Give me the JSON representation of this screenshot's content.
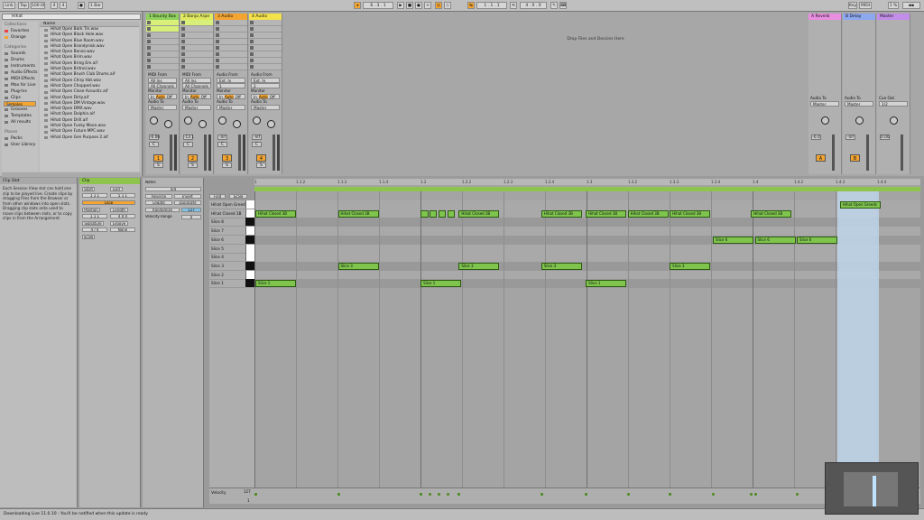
{
  "transport": {
    "link": "Link",
    "tap": "Tap",
    "tempo": "100.00",
    "sig_num": "4",
    "sig_den": "4",
    "quant": "1 Bar",
    "pos": "6 . 3 . 1",
    "loop_start": "1 . 1 . 1",
    "loop_len": "4 . 0 . 0",
    "midi": "MIDI",
    "cpu": "1 %",
    "key": "Key"
  },
  "browser": {
    "search": "Hihat",
    "collections_hdr": "Collections",
    "favorites": "Favorites",
    "orange": "Orange",
    "categories_hdr": "Categories",
    "categories": [
      "Sounds",
      "Drums",
      "Instruments",
      "Audio Effects",
      "MIDI Effects",
      "Max for Live",
      "Plug-Ins",
      "Clips",
      "Samples",
      "Grooves",
      "Templates",
      "All results"
    ],
    "places_hdr": "Places",
    "places": [
      "Packs",
      "User Library"
    ],
    "files_hdr": "Name",
    "files": [
      "Hihat Open Bark Tin.wav",
      "Hihat Open Black Hole.wav",
      "Hihat Open Blue Room.wav",
      "Hihat Open Brandynisk.wav",
      "Hihat Open Bonzo.wav",
      "Hihat Open Brim.wav",
      "Hihat Open Bring Em.aif",
      "Hihat Open Britnol.wav",
      "Hihat Open Brush Club Drums.aif",
      "Hihat Open Chirp Hat.wav",
      "Hihat Open Chopped.wav",
      "Hihat Open Close Acoustic.aif",
      "Hihat Open Dirty.aif",
      "Hihat Open DM Vintage.wav",
      "Hihat Open DMX.wav",
      "Hihat Open Dolphin.aif",
      "Hihat Open Drill.aif",
      "Hihat Open Funky Moon.wav",
      "Hihat Open Future MPC.wav",
      "Hihat Open Gen Purpose 2.aif"
    ]
  },
  "tracks": [
    {
      "name": "1 Bounty Box",
      "color": "#8ed15c",
      "io1": "MIDI From",
      "io2": "All Ins",
      "io3": "All Channels",
      "mon": "Monitor",
      "in": "In",
      "auto": "Auto",
      "off": "Off",
      "to": "Audio To",
      "dest": "Master",
      "vol": "-6.00",
      "pan": "C",
      "num": "1"
    },
    {
      "name": "2 Banjo Arpe",
      "color": "#dfe95f",
      "io1": "MIDI From",
      "io2": "All Ins",
      "io3": "All Channels",
      "mon": "Monitor",
      "in": "In",
      "auto": "Auto",
      "off": "Off",
      "to": "Audio To",
      "dest": "Master",
      "vol": "-13.1",
      "pan": "C",
      "num": "2"
    },
    {
      "name": "3 Audio",
      "color": "#f4a531",
      "io1": "Audio From",
      "io2": "Ext. In",
      "io3": "1",
      "mon": "Monitor",
      "in": "In",
      "auto": "Auto",
      "off": "Off",
      "to": "Audio To",
      "dest": "Master",
      "vol": "-Inf",
      "pan": "C",
      "num": "3"
    },
    {
      "name": "4 Audio",
      "color": "#f4e24a",
      "io1": "Audio From",
      "io2": "Ext. In",
      "io3": "2",
      "mon": "Monitor",
      "in": "In",
      "auto": "Auto",
      "off": "Off",
      "to": "Audio To",
      "dest": "Master",
      "vol": "-Inf",
      "pan": "C",
      "num": "4"
    }
  ],
  "returns": [
    {
      "name": "A Reverb",
      "color": "#e98ee0",
      "to": "Audio To",
      "dest": "Master",
      "vol": "-6.0",
      "letter": "A"
    },
    {
      "name": "B Delay",
      "color": "#8ea8f0",
      "to": "Audio To",
      "dest": "Master",
      "vol": "-Inf",
      "letter": "B"
    },
    {
      "name": "Master",
      "color": "#c28ee9",
      "to": "Cue Out",
      "dest": "1/2",
      "vol": "0.00",
      "letter": ""
    }
  ],
  "drop_text": "Drop Files and Devices Here",
  "info": {
    "title": "Clip Slot",
    "text": "Each Session View slot can hold one clip to be played live. Create clips by dragging Files from the Browser or from other windows into open slots. Dragging clip slots onto used to move clips between slots, or to copy clips in from the Arrangement."
  },
  "clip": {
    "title": "Clip",
    "start": "Start",
    "end": "End",
    "loop": "Loop",
    "position": "Position",
    "length": "Length",
    "signature": "Signature",
    "groove": "Groove",
    "scale": "Scale",
    "none": "None",
    "start_val": "1  1  1",
    "end_val": "5  1  1",
    "pos_val": "1  1  1",
    "len_val": "4  0  0",
    "sig_val": "4 / 4"
  },
  "notes": {
    "title": "Notes",
    "val": "4/4",
    "reverse": "Reverse",
    "invert": "Invert",
    "legato": "Legato",
    "duplicate": "Duplicate",
    "randomize": "Randomize",
    "rand_val": "127",
    "vel_range": "Velocity Range",
    "vel_val": "0"
  },
  "editor": {
    "fold": "Fold",
    "scale": "Scale",
    "velocity_label": "Velocity",
    "vel_max": "127",
    "vel_min": "1"
  },
  "lanes": [
    "Hihat Open Greeds",
    "Hihat Closed 3B",
    "Slice 8",
    "Slice 7",
    "Slice 6",
    "Slice 5",
    "Slice 4",
    "Slice 3",
    "Slice 2",
    "Slice 1"
  ],
  "ruler_ticks": [
    "1",
    "1.1.2",
    "1.1.3",
    "1.1.4",
    "1.2",
    "1.2.2",
    "1.2.3",
    "1.2.4",
    "1.3",
    "1.3.2",
    "1.3.3",
    "1.3.4",
    "1.4",
    "1.4.2",
    "1.4.3",
    "1.4.4"
  ],
  "note_labels": {
    "open": "Hihat Open Greeds",
    "closed": "Hihat Closed 3B",
    "s6": "Slice 6",
    "s3": "Slice 3",
    "s1": "Slice 1"
  },
  "status": "Downloading Live 11.0.10 - You'll be notified when this update is ready"
}
